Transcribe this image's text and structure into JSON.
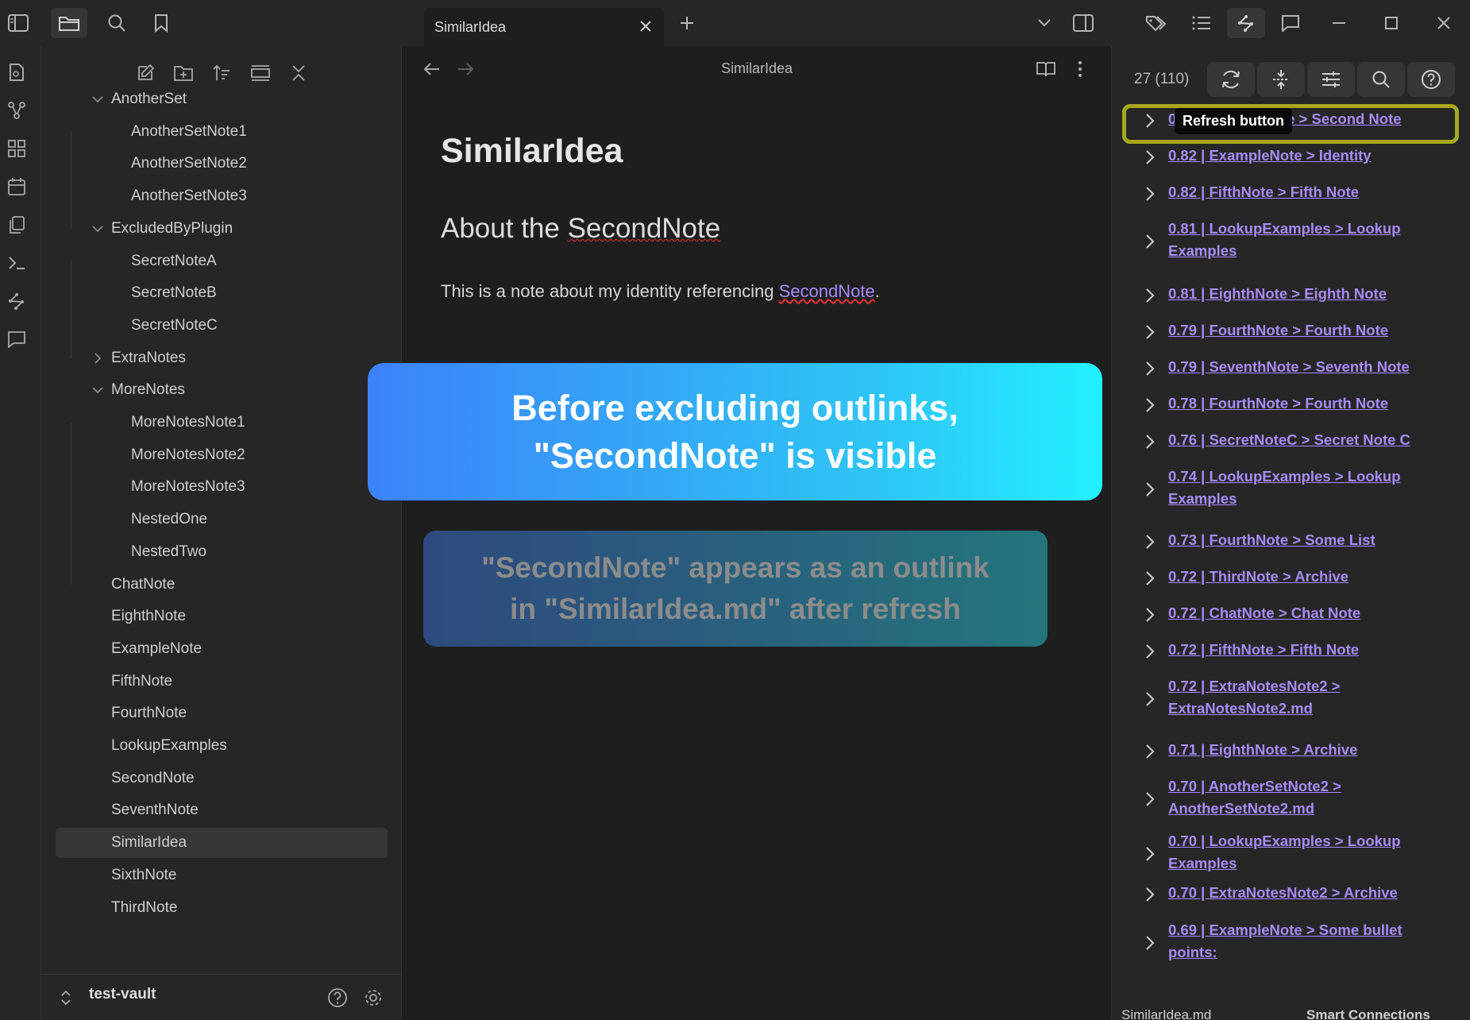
{
  "tab": {
    "title": "SimilarIdea"
  },
  "explorer": {
    "tree": [
      {
        "label": "AnotherSet",
        "type": "folder",
        "open": true
      },
      {
        "label": "AnotherSetNote1",
        "type": "file",
        "depth": 1
      },
      {
        "label": "AnotherSetNote2",
        "type": "file",
        "depth": 1
      },
      {
        "label": "AnotherSetNote3",
        "type": "file",
        "depth": 1
      },
      {
        "label": "ExcludedByPlugin",
        "type": "folder",
        "open": true
      },
      {
        "label": "SecretNoteA",
        "type": "file",
        "depth": 1
      },
      {
        "label": "SecretNoteB",
        "type": "file",
        "depth": 1
      },
      {
        "label": "SecretNoteC",
        "type": "file",
        "depth": 1
      },
      {
        "label": "ExtraNotes",
        "type": "folder",
        "open": false
      },
      {
        "label": "MoreNotes",
        "type": "folder",
        "open": true
      },
      {
        "label": "MoreNotesNote1",
        "type": "file",
        "depth": 1
      },
      {
        "label": "MoreNotesNote2",
        "type": "file",
        "depth": 1
      },
      {
        "label": "MoreNotesNote3",
        "type": "file",
        "depth": 1
      },
      {
        "label": "NestedOne",
        "type": "file",
        "depth": 1
      },
      {
        "label": "NestedTwo",
        "type": "file",
        "depth": 1
      },
      {
        "label": "ChatNote",
        "type": "file",
        "depth": 0
      },
      {
        "label": "EighthNote",
        "type": "file",
        "depth": 0
      },
      {
        "label": "ExampleNote",
        "type": "file",
        "depth": 0
      },
      {
        "label": "FifthNote",
        "type": "file",
        "depth": 0
      },
      {
        "label": "FourthNote",
        "type": "file",
        "depth": 0
      },
      {
        "label": "LookupExamples",
        "type": "file",
        "depth": 0
      },
      {
        "label": "SecondNote",
        "type": "file",
        "depth": 0
      },
      {
        "label": "SeventhNote",
        "type": "file",
        "depth": 0
      },
      {
        "label": "SimilarIdea",
        "type": "file",
        "depth": 0,
        "selected": true
      },
      {
        "label": "SixthNote",
        "type": "file",
        "depth": 0
      },
      {
        "label": "ThirdNote",
        "type": "file",
        "depth": 0
      }
    ],
    "vault_name": "test-vault"
  },
  "editor": {
    "nav_title": "SimilarIdea",
    "h1": "SimilarIdea",
    "h2_prefix": "About the ",
    "h2_link": "SecondNote",
    "para_prefix": "This is a note about my identity referencing ",
    "para_link": "SecondNote",
    "para_suffix": "."
  },
  "banners": {
    "b1_line1": "Before excluding outlinks,",
    "b1_line2": "\"SecondNote\" is visible",
    "b2_line1": "\"SecondNote\" appears as an outlink",
    "b2_line2": "in \"SimilarIdea.md\" after refresh"
  },
  "connections": {
    "count": "27 (110)",
    "tooltip": "Refresh button",
    "results": [
      {
        "text": "0.83 | SecondNote > Second Note"
      },
      {
        "text": "0.82 | ExampleNote > Identity"
      },
      {
        "text": "0.82 | FifthNote > Fifth Note"
      },
      {
        "text": "0.81 | LookupExamples > Lookup Examples"
      },
      {
        "text": "0.81 | EighthNote > Eighth Note"
      },
      {
        "text": "0.79 | FourthNote > Fourth Note"
      },
      {
        "text": "0.79 | SeventhNote > Seventh Note"
      },
      {
        "text": "0.78 | FourthNote > Fourth Note"
      },
      {
        "text": "0.76 | SecretNoteC > Secret Note C"
      },
      {
        "text": "0.74 | LookupExamples > Lookup Examples"
      },
      {
        "text": "0.73 | FourthNote > Some List"
      },
      {
        "text": "0.72 | ThirdNote > Archive"
      },
      {
        "text": "0.72 | ChatNote > Chat Note"
      },
      {
        "text": "0.72 | FifthNote > Fifth Note"
      },
      {
        "text": "0.72 | ExtraNotesNote2 > ExtraNotesNote2.md"
      },
      {
        "text": "0.71 | EighthNote > Archive"
      },
      {
        "text": "0.70 | AnotherSetNote2 > AnotherSetNote2.md"
      },
      {
        "text": "0.70 | LookupExamples > Lookup Examples"
      },
      {
        "text": "0.70 | ExtraNotesNote2 > Archive"
      },
      {
        "text": "0.69 | ExampleNote > Some bullet points:"
      }
    ],
    "status_file": "SimilarIdea.md",
    "status_plugin": "Smart Connections"
  },
  "colors": {
    "accent": "#a88bfa",
    "highlight": "#a8a61c",
    "bg": "#1e1e1e",
    "panel": "#262626"
  }
}
